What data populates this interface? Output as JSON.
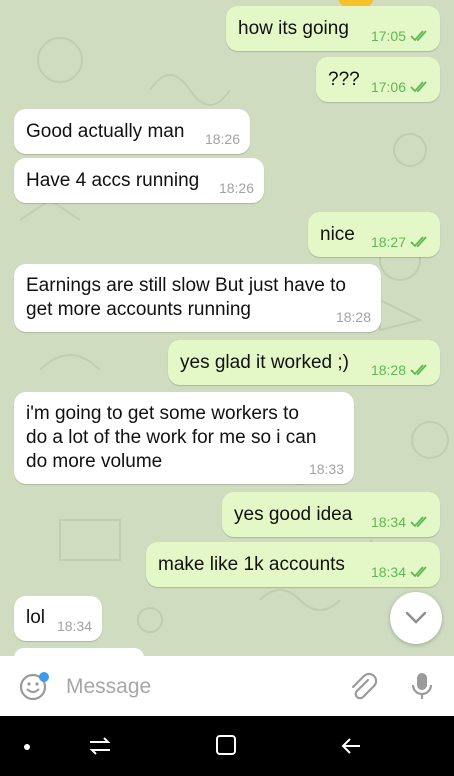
{
  "messages": [
    {
      "text": "how its going",
      "time": "17:05",
      "dir": "out"
    },
    {
      "text": "???",
      "time": "17:06",
      "dir": "out"
    },
    {
      "text": "Good actually man",
      "time": "18:26",
      "dir": "in"
    },
    {
      "text": "Have 4 accs running",
      "time": "18:26",
      "dir": "in"
    },
    {
      "text": "nice",
      "time": "18:27",
      "dir": "out"
    },
    {
      "text": "Earnings are still slow But just have to\nget more accounts running",
      "time": "18:28",
      "dir": "in"
    },
    {
      "text": "yes glad it worked ;)",
      "time": "18:28",
      "dir": "out"
    },
    {
      "text": "i'm going to get some workers to\ndo a lot of the work for me so i can\ndo more volume",
      "time": "18:33",
      "dir": "in"
    },
    {
      "text": "yes good idea",
      "time": "18:34",
      "dir": "out"
    },
    {
      "text": "make like 1k accounts",
      "time": "18:34",
      "dir": "out"
    },
    {
      "text": "lol",
      "time": "18:34",
      "dir": "in"
    }
  ],
  "composer": {
    "placeholder": "Message"
  },
  "icons": {
    "emoji": "emoji-icon",
    "attach": "paperclip-icon",
    "mic": "microphone-icon",
    "scroll_down": "chevron-down-icon",
    "nav_recents": "recents-icon",
    "nav_home": "home-icon",
    "nav_back": "back-icon"
  },
  "colors": {
    "outgoing_bubble": "#e3f8c6",
    "incoming_bubble": "#ffffff",
    "tick_green": "#5fb853",
    "chat_background": "#cfdcc0"
  }
}
